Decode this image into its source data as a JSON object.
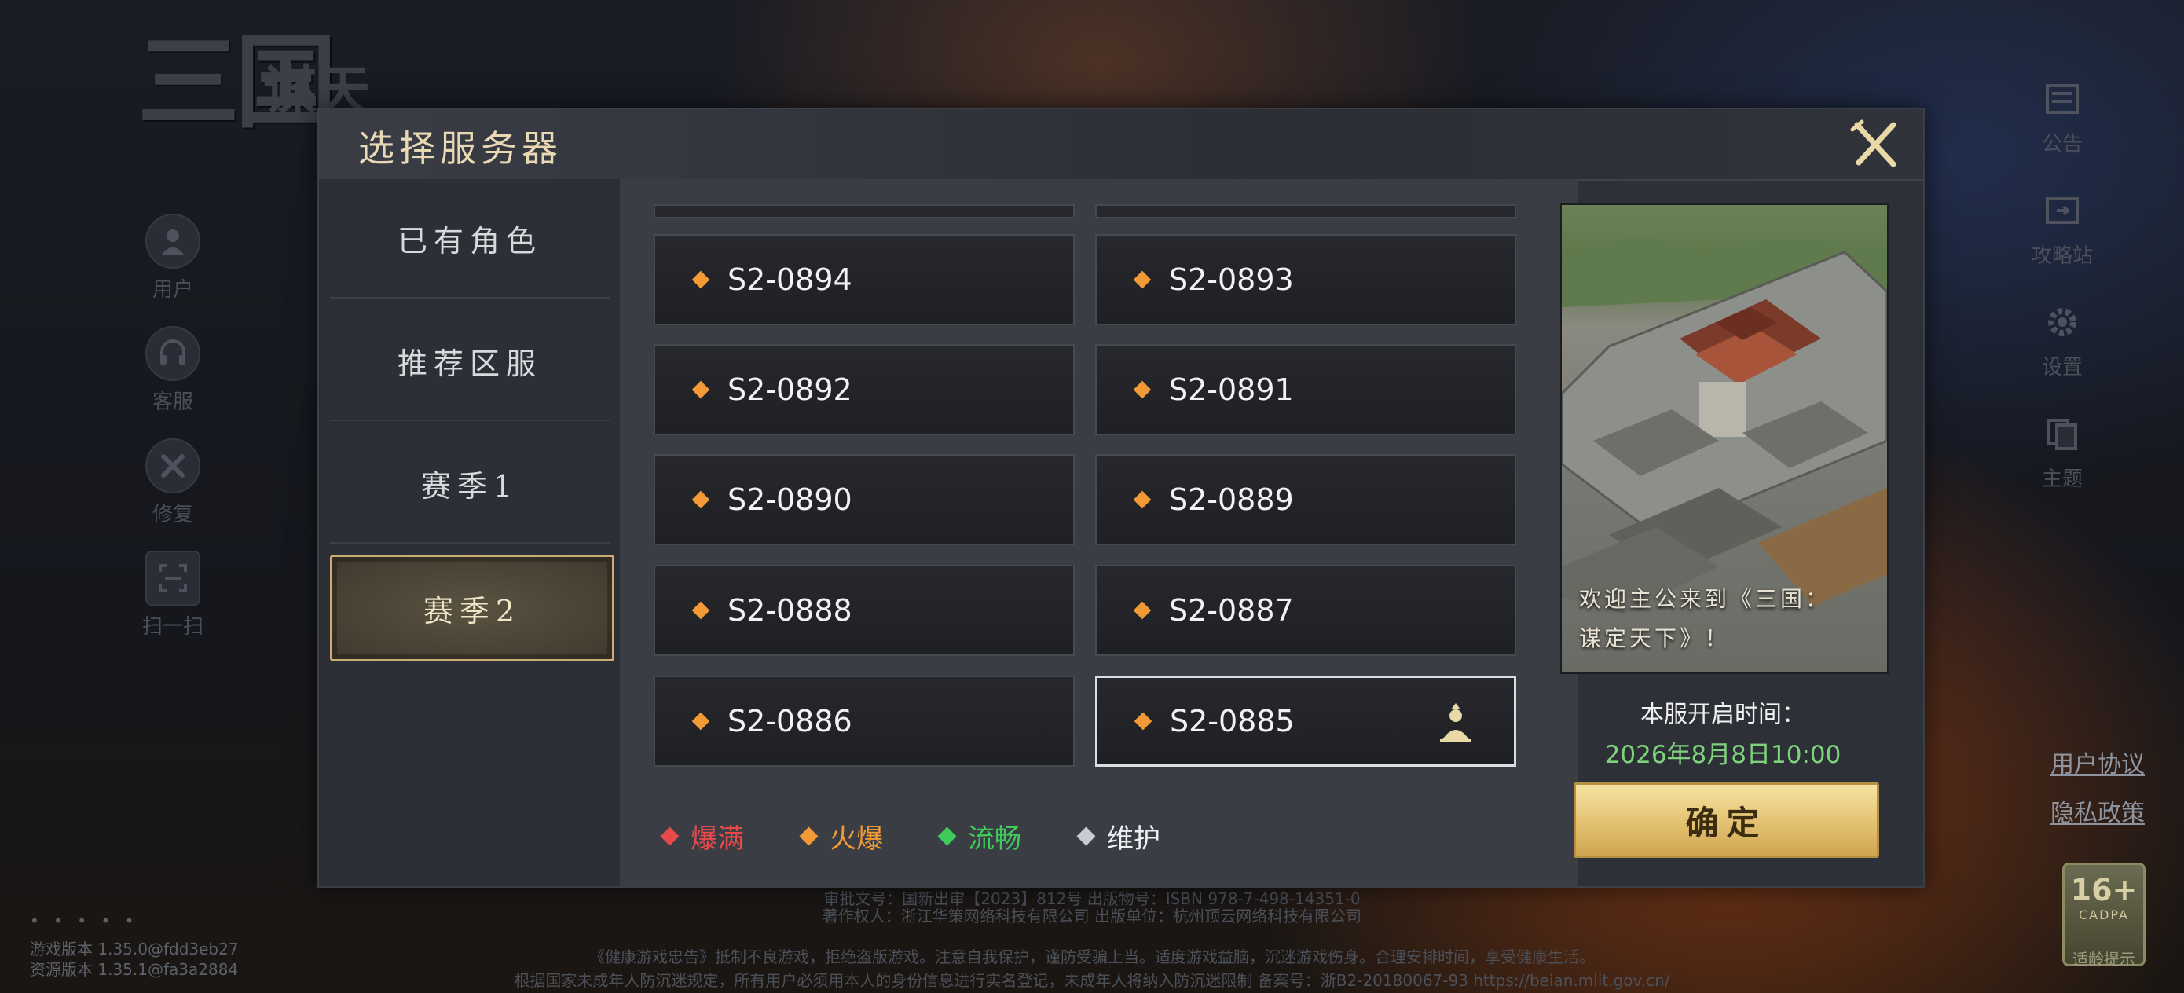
{
  "logo": {
    "text": "三国",
    "sub": "谋天"
  },
  "side_menu": [
    {
      "icon": "user-icon",
      "label": "用户"
    },
    {
      "icon": "headset-icon",
      "label": "客服"
    },
    {
      "icon": "wrench-icon",
      "label": "修复"
    },
    {
      "icon": "scan-icon",
      "label": "扫一扫"
    }
  ],
  "right_menu": [
    {
      "icon": "announcement-icon",
      "label": "公告"
    },
    {
      "icon": "guide-icon",
      "label": "攻略站"
    },
    {
      "icon": "gear-icon",
      "label": "设置"
    },
    {
      "icon": "theme-icon",
      "label": "主题"
    }
  ],
  "links": {
    "user_agreement": "用户协议",
    "privacy": "隐私政策"
  },
  "age": {
    "rating": "16+",
    "org": "CADPA",
    "tip": "适龄提示"
  },
  "version": {
    "dots": "• • • • •",
    "game": "游戏版本 1.35.0@fdd3eb27",
    "res": "资源版本 1.35.1@fa3a2884"
  },
  "footer": {
    "line1": "审批文号：国新出审【2023】812号  出版物号：ISBN 978-7-498-14351-0",
    "line2": "著作权人：浙江华策网络科技有限公司  出版单位：杭州顶云网络科技有限公司",
    "line3": "《健康游戏忠告》抵制不良游戏，拒绝盗版游戏。注意自我保护，谨防受骗上当。适度游戏益脑，沉迷游戏伤身。合理安排时间，享受健康生活。",
    "line4": "根据国家未成年人防沉迷规定，所有用户必须用本人的身份信息进行实名登记，未成年人将纳入防沉迷限制  备案号：浙B2-20180067-93 https://beian.miit.gov.cn/"
  },
  "dialog": {
    "title": "选择服务器",
    "tabs": [
      {
        "label": "已有角色",
        "active": false
      },
      {
        "label": "推荐区服",
        "active": false
      },
      {
        "label": "赛季1",
        "active": false
      },
      {
        "label": "赛季2",
        "active": true
      }
    ],
    "servers": [
      {
        "name": "S2-0894",
        "status": "hot"
      },
      {
        "name": "S2-0893",
        "status": "hot"
      },
      {
        "name": "S2-0892",
        "status": "hot"
      },
      {
        "name": "S2-0891",
        "status": "hot"
      },
      {
        "name": "S2-0890",
        "status": "hot"
      },
      {
        "name": "S2-0889",
        "status": "hot"
      },
      {
        "name": "S2-0888",
        "status": "hot"
      },
      {
        "name": "S2-0887",
        "status": "hot"
      },
      {
        "name": "S2-0886",
        "status": "hot"
      },
      {
        "name": "S2-0885",
        "status": "hot",
        "selected": true,
        "has_role": true
      }
    ],
    "legend": [
      {
        "label": "爆满",
        "color": "#e84a4a"
      },
      {
        "label": "火爆",
        "color": "#f29a36"
      },
      {
        "label": "流畅",
        "color": "#3ecb5a"
      },
      {
        "label": "维护",
        "color": "#c8ccd3"
      }
    ],
    "status_colors": {
      "full": "#e84a4a",
      "hot": "#f29a36",
      "smooth": "#3ecb5a",
      "maintenance": "#c8ccd3"
    },
    "promo": {
      "caption_line1": "欢迎主公来到《三国：",
      "caption_line2": "谋定天下》！"
    },
    "open_label": "本服开启时间：",
    "open_time": "2026年8月8日10:00",
    "confirm": "确定"
  }
}
